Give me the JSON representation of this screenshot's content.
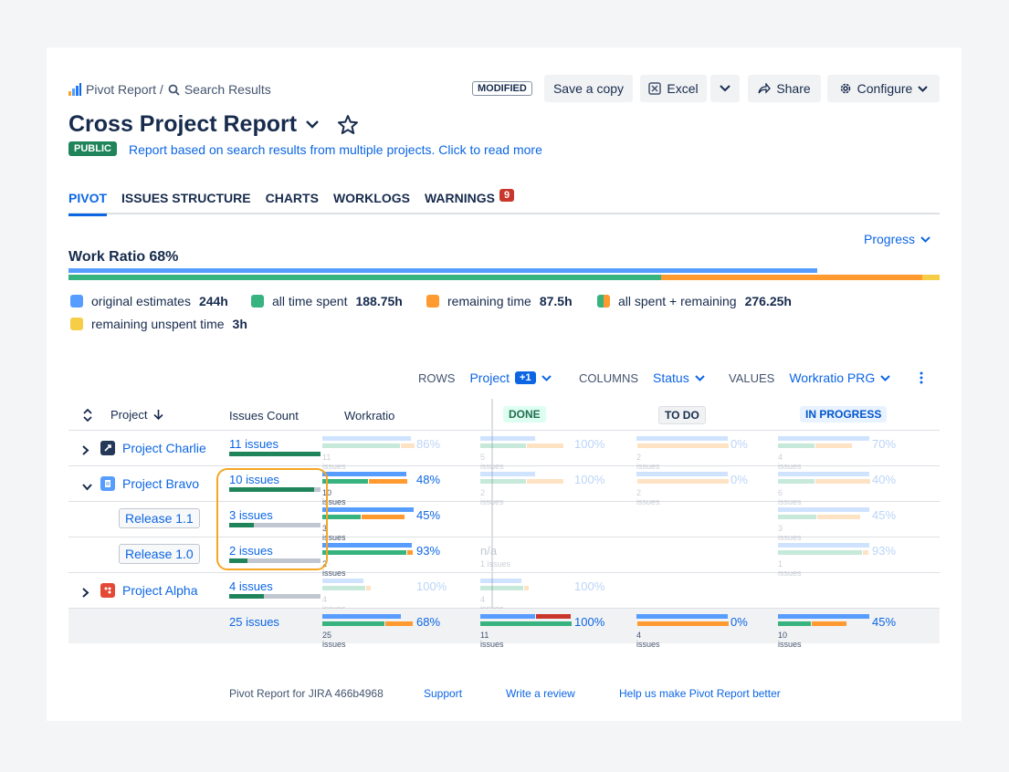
{
  "breadcrumb": {
    "root": "Pivot Report /",
    "current": "Search Results"
  },
  "toolbar": {
    "modified": "MODIFIED",
    "save_copy": "Save a copy",
    "excel": "Excel",
    "share": "Share",
    "configure": "Configure"
  },
  "report": {
    "title": "Cross Project Report",
    "visibility": "PUBLIC",
    "description": "Report based on search results from multiple projects. Click to read more"
  },
  "tabs": [
    {
      "label": "PIVOT",
      "active": true
    },
    {
      "label": "ISSUES STRUCTURE"
    },
    {
      "label": "CHARTS"
    },
    {
      "label": "WORKLOGS"
    },
    {
      "label": "WARNINGS",
      "badge": "9"
    }
  ],
  "progress_dropdown": "Progress",
  "work_ratio": {
    "label": "Work Ratio",
    "value": "68%",
    "original_fraction": 0.86,
    "spent_fraction": 0.68,
    "remaining_fraction": 0.3,
    "unspent_fraction": 0.02
  },
  "legend": [
    {
      "label": "original estimates",
      "value": "244h",
      "color": "#579dff"
    },
    {
      "label": "all time spent",
      "value": "188.75h",
      "color": "#36b37e"
    },
    {
      "label": "remaining time",
      "value": "87.5h",
      "color": "#fe9a2f"
    },
    {
      "label": "all spent + remaining",
      "value": "276.25h",
      "color": "split"
    },
    {
      "label": "remaining unspent time",
      "value": "3h",
      "color": "#f5cd47"
    }
  ],
  "controls": {
    "rows_label": "ROWS",
    "rows_value": "Project",
    "rows_extra": "+1",
    "columns_label": "COLUMNS",
    "columns_value": "Status",
    "values_label": "VALUES",
    "values_value": "Workratio PRG"
  },
  "table": {
    "headers": {
      "project": "Project",
      "issues_count": "Issues Count",
      "workratio": "Workratio",
      "done": "DONE",
      "todo": "TO DO",
      "in_progress": "IN PROGRESS"
    },
    "rows": [
      {
        "name": "Project Charlie",
        "issues": "11 issues",
        "wr": "86%",
        "wr_sub": "11 issues",
        "done": "100%",
        "done_sub": "5 issues",
        "todo": "0%",
        "todo_sub": "2 issues",
        "prog": "70%",
        "prog_sub": "4 issues"
      },
      {
        "name": "Project Bravo",
        "issues": "10 issues",
        "wr": "48%",
        "wr_sub": "10 issues",
        "done": "100%",
        "done_sub": "2 issues",
        "todo": "0%",
        "todo_sub": "2 issues",
        "prog": "40%",
        "prog_sub": "6 issues"
      },
      {
        "name": "Release 1.1",
        "issues": "3 issues",
        "wr": "45%",
        "wr_sub": "3 issues",
        "prog": "45%",
        "prog_sub": "3 issues"
      },
      {
        "name": "Release 1.0",
        "issues": "2 issues",
        "wr": "93%",
        "wr_sub": "2 issues",
        "done": "n/a",
        "done_sub": "1 issues",
        "prog": "93%",
        "prog_sub": "1 issues"
      },
      {
        "name": "Project Alpha",
        "issues": "4 issues",
        "wr": "100%",
        "wr_sub": "4 issues",
        "done": "100%",
        "done_sub": "4 issues"
      }
    ],
    "total": {
      "issues": "25 issues",
      "wr": "68%",
      "wr_sub": "25 issues",
      "done": "100%",
      "done_sub": "11 issues",
      "todo": "0%",
      "todo_sub": "4 issues",
      "prog": "45%",
      "prog_sub": "10 issues"
    }
  },
  "footer": {
    "version": "Pivot Report for JIRA 466b4968",
    "support": "Support",
    "review": "Write a review",
    "feedback": "Help us make Pivot Report better"
  }
}
